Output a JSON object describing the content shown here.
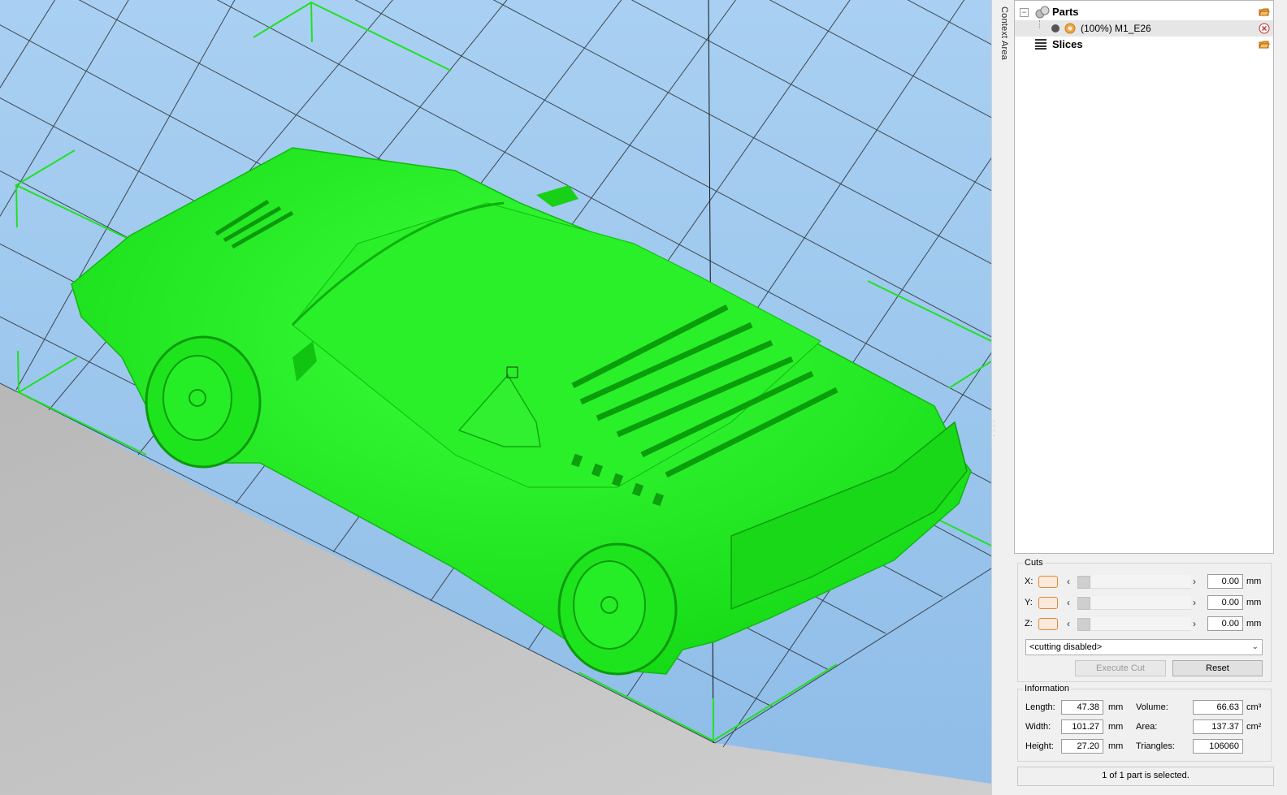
{
  "side_tab": {
    "label": "Context Area"
  },
  "tree": {
    "parts_label": "Parts",
    "part_item_label": "(100%) M1_E26",
    "slices_label": "Slices"
  },
  "cuts": {
    "title": "Cuts",
    "rows": [
      {
        "axis": "X:",
        "value": "0.00",
        "unit": "mm"
      },
      {
        "axis": "Y:",
        "value": "0.00",
        "unit": "mm"
      },
      {
        "axis": "Z:",
        "value": "0.00",
        "unit": "mm"
      }
    ],
    "mode_selected": "<cutting disabled>",
    "execute_label": "Execute Cut",
    "reset_label": "Reset"
  },
  "information": {
    "title": "Information",
    "length_label": "Length:",
    "length_value": "47.38",
    "length_unit": "mm",
    "width_label": "Width:",
    "width_value": "101.27",
    "width_unit": "mm",
    "height_label": "Height:",
    "height_value": "27.20",
    "height_unit": "mm",
    "volume_label": "Volume:",
    "volume_value": "66.63",
    "volume_unit": "cm³",
    "area_label": "Area:",
    "area_value": "137.37",
    "area_unit": "cm²",
    "triangles_label": "Triangles:",
    "triangles_value": "106060"
  },
  "status": "1 of 1 part is selected.",
  "colors": {
    "model": "#22f022",
    "sky": "#9ec8ee",
    "floor": "#c4c4c4",
    "accent": "#e08a3a"
  }
}
